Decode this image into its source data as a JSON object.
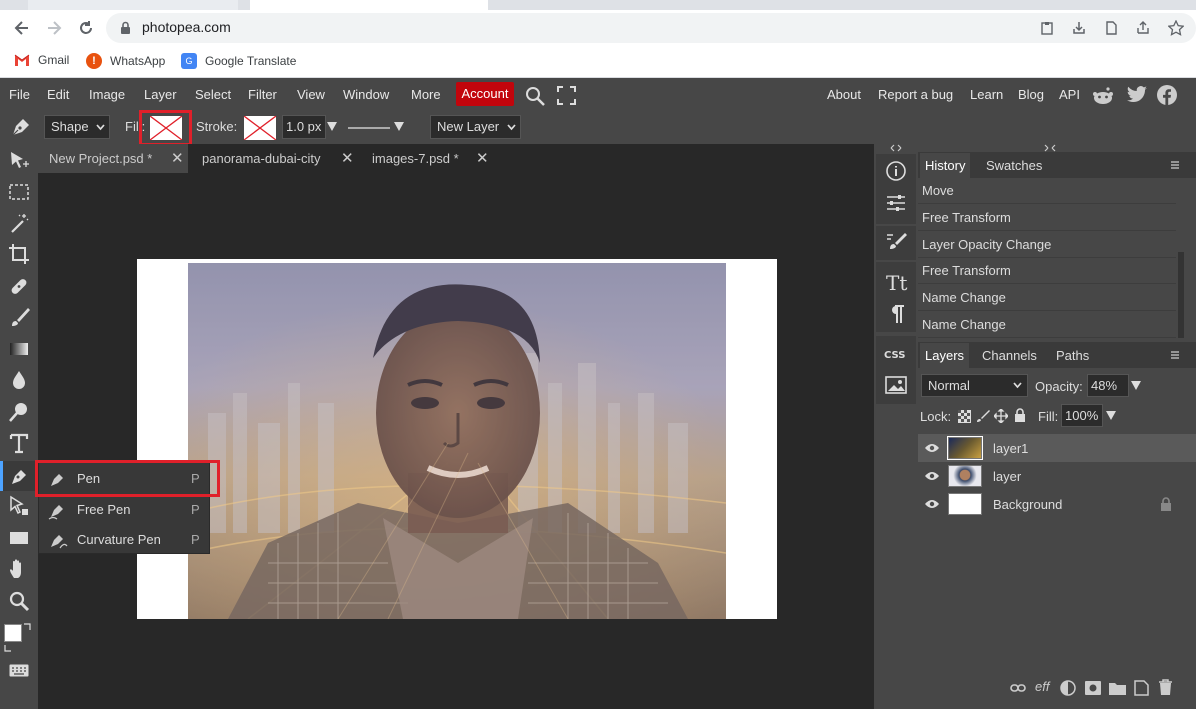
{
  "browser": {
    "url": "photopea.com",
    "bookmarks": [
      {
        "label": "Gmail",
        "icon": "gmail-icon"
      },
      {
        "label": "WhatsApp",
        "icon": "whatsapp-icon"
      },
      {
        "label": "Google Translate",
        "icon": "google-translate-icon"
      }
    ]
  },
  "menu": {
    "items": [
      "File",
      "Edit",
      "Image",
      "Layer",
      "Select",
      "Filter",
      "View",
      "Window",
      "More"
    ],
    "account": "Account",
    "right_items": [
      "About",
      "Report a bug",
      "Learn",
      "Blog",
      "API"
    ]
  },
  "options": {
    "mode": "Shape",
    "fill_label": "Fill:",
    "stroke_label": "Stroke:",
    "stroke_width": "1.0 px",
    "target": "New Layer"
  },
  "doc_tabs": [
    {
      "label": "New Project.psd *",
      "active": true
    },
    {
      "label": "panorama-dubai-city",
      "active": false
    },
    {
      "label": "images-7.psd *",
      "active": false
    }
  ],
  "pen_flyout": [
    {
      "label": "Pen",
      "key": "P"
    },
    {
      "label": "Free Pen",
      "key": "P"
    },
    {
      "label": "Curvature Pen",
      "key": "P"
    }
  ],
  "history_panel": {
    "tabs": [
      "History",
      "Swatches"
    ],
    "items": [
      "Move",
      "Free Transform",
      "Layer Opacity Change",
      "Free Transform",
      "Name Change",
      "Name Change"
    ]
  },
  "layers_panel": {
    "tabs": [
      "Layers",
      "Channels",
      "Paths"
    ],
    "blend_mode": "Normal",
    "opacity_label": "Opacity:",
    "opacity": "48%",
    "lock_label": "Lock:",
    "fill_label": "Fill:",
    "fill": "100%",
    "layers": [
      {
        "name": "layer1",
        "selected": true
      },
      {
        "name": "layer",
        "selected": false
      },
      {
        "name": "Background",
        "selected": false,
        "locked": true
      }
    ],
    "footer_text": "eff"
  },
  "colors": {
    "accent_red": "#c2050c",
    "highlight_box": "#e0202a",
    "panel_bg": "#474747",
    "workspace_bg": "#282828"
  }
}
